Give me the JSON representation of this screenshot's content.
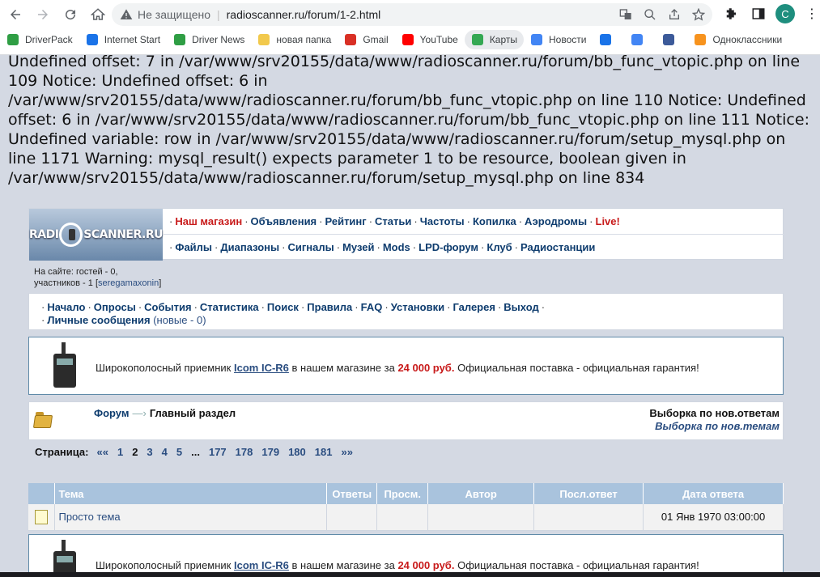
{
  "browser": {
    "not_secure": "Не защищено",
    "url": "radioscanner.ru/forum/1-2.html",
    "profile_initial": "C"
  },
  "bookmarks": [
    {
      "label": "DriverPack",
      "color": "#2f9e44"
    },
    {
      "label": "Internet Start",
      "color": "#1a73e8"
    },
    {
      "label": "Driver News",
      "color": "#2f9e44"
    },
    {
      "label": "новая папка",
      "color": "#f2c94c"
    },
    {
      "label": "Gmail",
      "color": "#d93025"
    },
    {
      "label": "YouTube",
      "color": "#ff0000"
    },
    {
      "label": "Карты",
      "color": "#34a853"
    },
    {
      "label": "Новости",
      "color": "#4285f4"
    },
    {
      "label": "",
      "color": "#1a73e8"
    },
    {
      "label": "",
      "color": "#4285f4"
    },
    {
      "label": "",
      "color": "#3c5a99"
    },
    {
      "label": "Одноклассники",
      "color": "#f7931e"
    }
  ],
  "errors_text": "Undefined offset: 7 in /var/www/srv20155/data/www/radioscanner.ru/forum/bb_func_vtopic.php on line 109 Notice: Undefined offset: 6 in /var/www/srv20155/data/www/radioscanner.ru/forum/bb_func_vtopic.php on line 110 Notice: Undefined offset: 6 in /var/www/srv20155/data/www/radioscanner.ru/forum/bb_func_vtopic.php on line 111 Notice: Undefined variable: row in /var/www/srv20155/data/www/radioscanner.ru/forum/setup_mysql.php on line 1171 Warning: mysql_result() expects parameter 1 to be resource, boolean given in /var/www/srv20155/data/www/radioscanner.ru/forum/setup_mysql.php on line 834",
  "logo": {
    "left": "RADI",
    "right": "SCANNER.RU"
  },
  "menu": {
    "row1": [
      {
        "label": "Наш магазин",
        "red": true
      },
      {
        "label": "Объявления"
      },
      {
        "label": "Рейтинг"
      },
      {
        "label": "Статьи"
      },
      {
        "label": "Частоты"
      },
      {
        "label": "Копилка"
      },
      {
        "label": "Аэродромы"
      },
      {
        "label": "Live!",
        "red": true
      }
    ],
    "row2": [
      {
        "label": "Файлы"
      },
      {
        "label": "Диапазоны"
      },
      {
        "label": "Сигналы"
      },
      {
        "label": "Музей"
      },
      {
        "label": "Mods"
      },
      {
        "label": "LPD-форум"
      },
      {
        "label": "Клуб"
      },
      {
        "label": "Радиостанции"
      }
    ]
  },
  "online": {
    "line1": "На сайте: гостей - 0,",
    "line2_prefix": "участников - 1 [",
    "user": "seregamaxonin",
    "line2_suffix": "]"
  },
  "forum_nav": {
    "line1": [
      "Начало",
      "Опросы",
      "События",
      "Статистика",
      "Поиск",
      "Правила",
      "FAQ",
      "Установки",
      "Галерея",
      "Выход"
    ],
    "pm_label": "Личные сообщения",
    "pm_new": "(новые - 0)"
  },
  "ad": {
    "prefix": "Широкополосный приемник",
    "model": "Icom IC-R6",
    "middle": "в нашем магазине за",
    "price": "24 000 руб.",
    "suffix": "Официальная поставка - официальная гарантия!"
  },
  "breadcrumb": {
    "forum": "Форум",
    "arrow": "—›",
    "current": "Главный раздел",
    "select_replies": "Выборка по нов.ответам",
    "select_topics": "Выборка по нов.темам"
  },
  "pager": {
    "label": "Страница:",
    "items": [
      {
        "t": "««"
      },
      {
        "t": "1"
      },
      {
        "t": "2",
        "cur": true
      },
      {
        "t": "3"
      },
      {
        "t": "4"
      },
      {
        "t": "5"
      },
      {
        "t": "...",
        "cur": true
      },
      {
        "t": "177"
      },
      {
        "t": "178"
      },
      {
        "t": "179"
      },
      {
        "t": "180"
      },
      {
        "t": "181"
      },
      {
        "t": "»»"
      }
    ]
  },
  "table": {
    "headers": [
      "",
      "Тема",
      "Ответы",
      "Просм.",
      "Автор",
      "Посл.ответ",
      "Дата ответа"
    ],
    "rows": [
      {
        "topic": "Просто тема",
        "replies": "",
        "views": "",
        "author": "",
        "last": "",
        "date": "01 Янв 1970 03:00:00"
      }
    ]
  }
}
